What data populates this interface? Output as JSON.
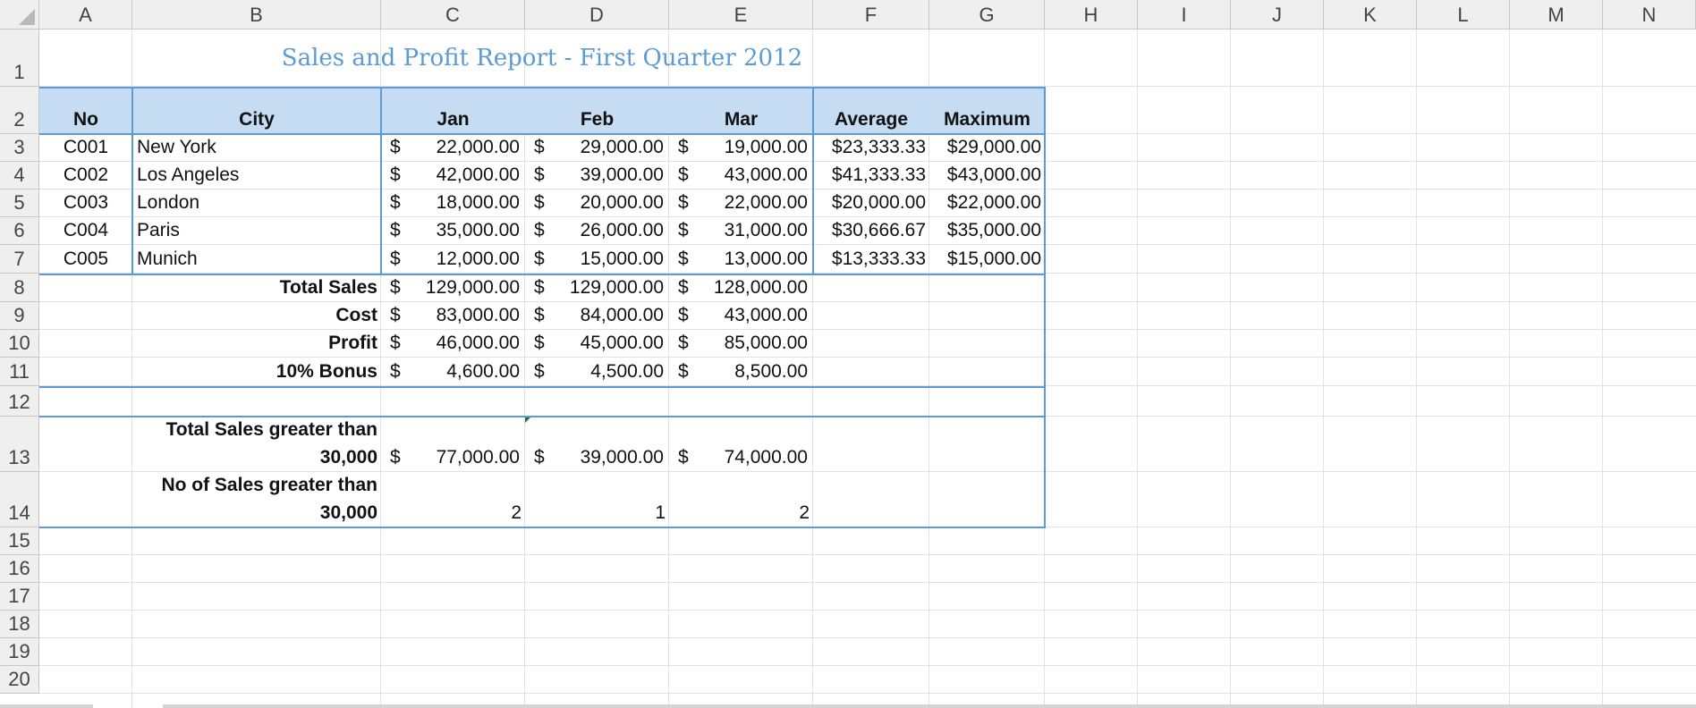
{
  "columns": [
    "A",
    "B",
    "C",
    "D",
    "E",
    "F",
    "G",
    "H",
    "I",
    "J",
    "K",
    "L",
    "M",
    "N"
  ],
  "rows": [
    "1",
    "2",
    "3",
    "4",
    "5",
    "6",
    "7",
    "8",
    "9",
    "10",
    "11",
    "12",
    "13",
    "14",
    "15",
    "16",
    "17",
    "18",
    "19",
    "20"
  ],
  "title": "Sales and Profit Report - First Quarter 2012",
  "headers": {
    "no": "No",
    "city": "City",
    "jan": "Jan",
    "feb": "Feb",
    "mar": "Mar",
    "average": "Average",
    "maximum": "Maximum"
  },
  "currency_symbol": "$",
  "data_rows": [
    {
      "no": "C001",
      "city": "New York",
      "jan": "22,000.00",
      "feb": "29,000.00",
      "mar": "19,000.00",
      "avg": "$23,333.33",
      "max": "$29,000.00"
    },
    {
      "no": "C002",
      "city": "Los Angeles",
      "jan": "42,000.00",
      "feb": "39,000.00",
      "mar": "43,000.00",
      "avg": "$41,333.33",
      "max": "$43,000.00"
    },
    {
      "no": "C003",
      "city": "London",
      "jan": "18,000.00",
      "feb": "20,000.00",
      "mar": "22,000.00",
      "avg": "$20,000.00",
      "max": "$22,000.00"
    },
    {
      "no": "C004",
      "city": "Paris",
      "jan": "35,000.00",
      "feb": "26,000.00",
      "mar": "31,000.00",
      "avg": "$30,666.67",
      "max": "$35,000.00"
    },
    {
      "no": "C005",
      "city": "Munich",
      "jan": "12,000.00",
      "feb": "15,000.00",
      "mar": "13,000.00",
      "avg": "$13,333.33",
      "max": "$15,000.00"
    }
  ],
  "summary_rows": [
    {
      "label": "Total Sales",
      "jan": "129,000.00",
      "feb": "129,000.00",
      "mar": "128,000.00"
    },
    {
      "label": "Cost",
      "jan": "83,000.00",
      "feb": "84,000.00",
      "mar": "43,000.00"
    },
    {
      "label": "Profit",
      "jan": "46,000.00",
      "feb": "45,000.00",
      "mar": "85,000.00"
    },
    {
      "label": "10% Bonus",
      "jan": "4,600.00",
      "feb": "4,500.00",
      "mar": "8,500.00"
    }
  ],
  "greater_than": {
    "total_label_line1": "Total Sales greater than",
    "total_label_line2": "30,000",
    "total_jan": "77,000.00",
    "total_feb": "39,000.00",
    "total_mar": "74,000.00",
    "count_label_line1": "No of Sales greater than",
    "count_label_line2": "30,000",
    "count_jan": "2",
    "count_feb": "1",
    "count_mar": "2"
  },
  "colors": {
    "accent": "#5b9bd5",
    "header_fill": "#c5dcf2",
    "gridline": "#e1e1e1",
    "header_bg": "#efefef"
  }
}
